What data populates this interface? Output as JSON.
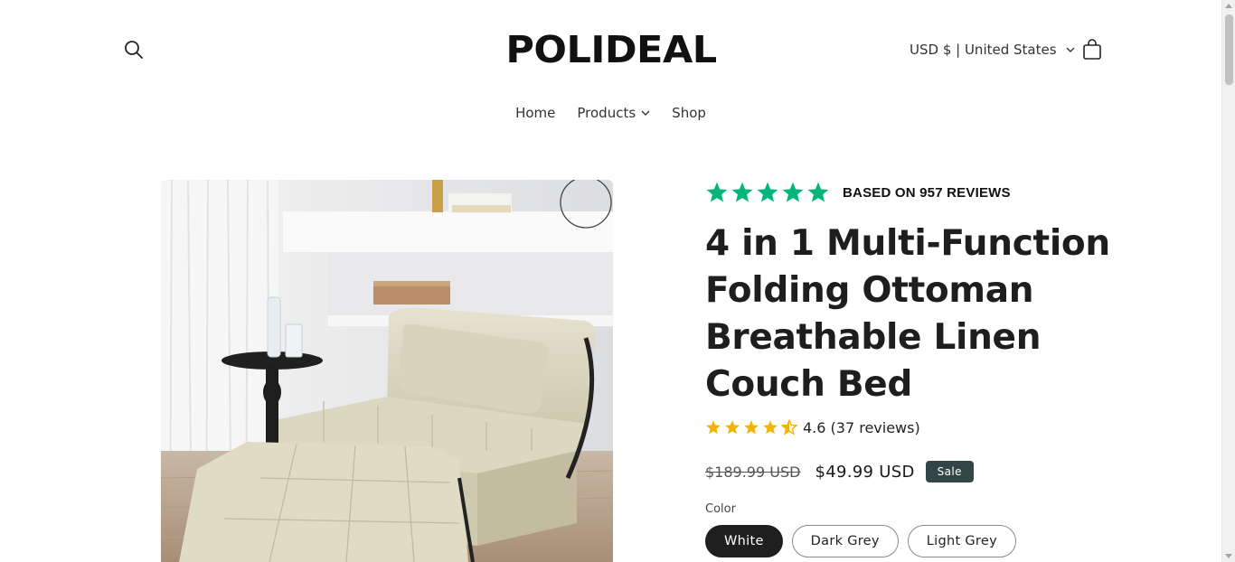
{
  "header": {
    "logo": "POLIDEAL",
    "currency": "USD $ | United States"
  },
  "nav": {
    "home": "Home",
    "products": "Products",
    "shop": "Shop"
  },
  "product": {
    "trust_reviews": "BASED ON 957 REVIEWS",
    "title": "4 in 1 Multi-Function Folding Ottoman Breathable Linen Couch Bed",
    "rating_text": "4.6 (37 reviews)",
    "rating_value": 4.6,
    "price_compare": "$189.99 USD",
    "price_sale": "$49.99 USD",
    "sale_badge": "Sale",
    "color_label": "Color",
    "colors": [
      "White",
      "Dark Grey",
      "Light Grey"
    ],
    "selected_color": "White"
  },
  "colors": {
    "trust_star": "#00b67a",
    "rating_star": "#f5b301",
    "badge": "#334544"
  }
}
